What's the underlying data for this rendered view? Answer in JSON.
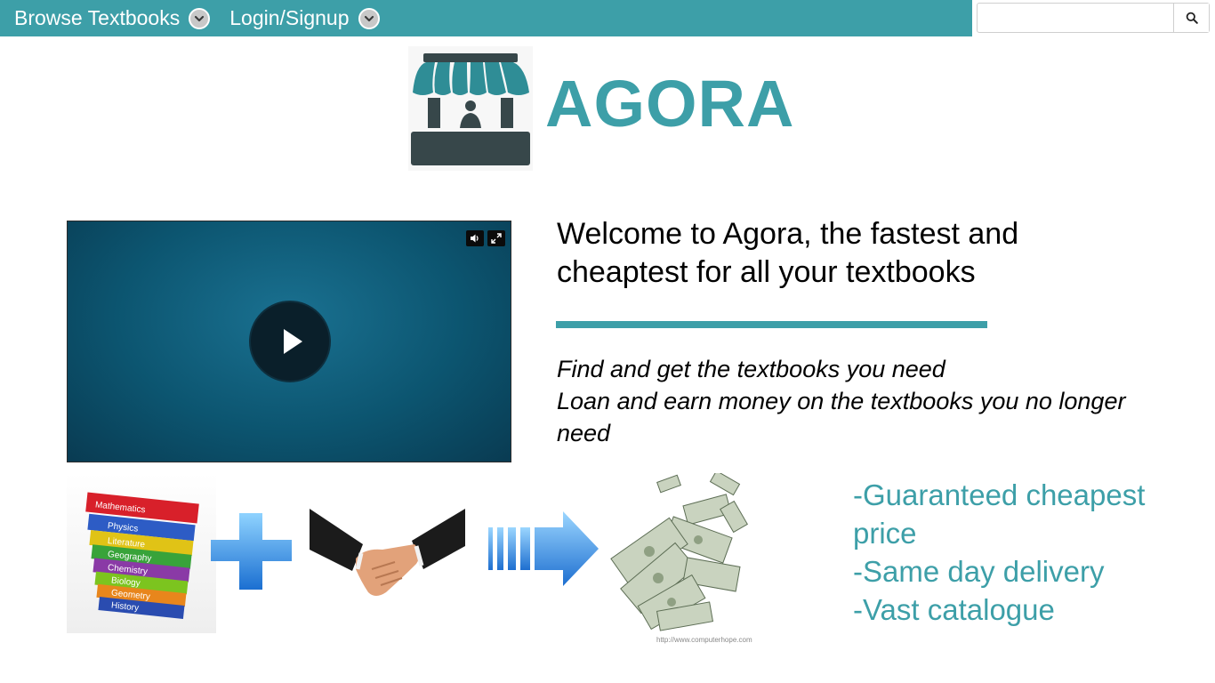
{
  "nav": {
    "browse_label": "Browse Textbooks",
    "login_label": "Login/Signup"
  },
  "search": {
    "value": "",
    "placeholder": ""
  },
  "brand": {
    "name": "AGORA"
  },
  "hero": {
    "welcome": "Welcome to Agora, the fastest and cheaptest for all your textbooks",
    "taglines": [
      "Find and get the textbooks you need",
      "Loan and earn money on the textbooks you no longer need"
    ]
  },
  "features": [
    "-Guaranteed cheapest price",
    "-Same day delivery",
    "-Vast catalogue"
  ],
  "illustration": {
    "book_spines": [
      "Mathematics",
      "Physics",
      "Literature",
      "Geography",
      "Chemistry",
      "Biology",
      "Geometry",
      "History"
    ],
    "credit": "http://www.computerhope.com"
  },
  "icons": {
    "browse_dropdown": "chevron-down-icon",
    "login_dropdown": "chevron-down-icon",
    "search": "search-icon",
    "volume": "volume-icon",
    "fullscreen": "fullscreen-icon",
    "play": "play-icon"
  },
  "colors": {
    "accent": "#3d9fa8",
    "video_bg": "#0c5570",
    "logo_dark": "#37474a"
  }
}
